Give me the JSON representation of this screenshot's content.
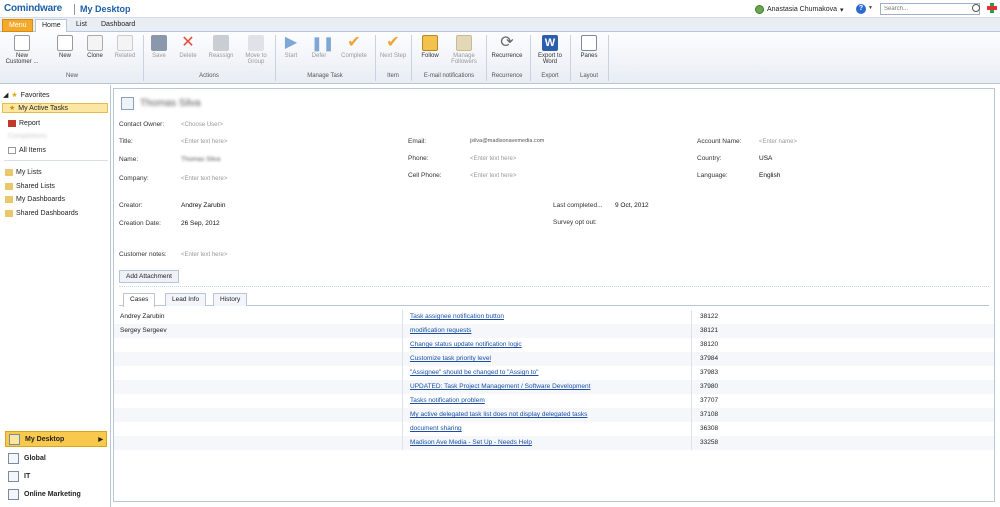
{
  "header": {
    "logo": "Comindware",
    "title": "My Desktop",
    "user": "Anastasia Chumakova",
    "search_placeholder": "Search..."
  },
  "tabs": [
    "Menu",
    "Home",
    "List",
    "Dashboard"
  ],
  "ribbon": {
    "groups": [
      "New",
      "Actions",
      "Manage Task",
      "Item",
      "E-mail notifications",
      "Recurrence",
      "Export",
      "Layout"
    ],
    "buttons": {
      "new_customer": "New Customer ...",
      "new": "New",
      "clone": "Clone",
      "related": "Related",
      "save": "Save",
      "delete": "Delete",
      "reassign": "Reassign",
      "move_to_group": "Move to Group",
      "start": "Start",
      "defer": "Defer",
      "complete": "Complete",
      "next_step": "Next Step",
      "follow": "Follow",
      "manage_followers": "Manage Followers",
      "recurrence": "Recurrence",
      "export_word": "Export to Word",
      "panes": "Panes"
    }
  },
  "sidebar": {
    "favorites": "Favorites",
    "my_active_tasks": "My Active Tasks",
    "report": "Report",
    "completions": "Completions",
    "all_items": "All Items",
    "my_lists": "My Lists",
    "shared_lists": "Shared Lists",
    "my_dashboards": "My Dashboards",
    "shared_dashboards": "Shared Dashboards",
    "workspaces": [
      "My Desktop",
      "Global",
      "IT",
      "Online Marketing"
    ]
  },
  "form": {
    "name_heading": "Thomas Silva",
    "contact_owner_label": "Contact Owner:",
    "contact_owner_placeholder": "<Choose User>",
    "title_label": "Title:",
    "title_placeholder": "<Enter text here>",
    "name_label": "Name:",
    "name_value": "Thomas Silva",
    "company_label": "Company:",
    "company_placeholder": "<Enter text here>",
    "email_label": "Email:",
    "email_value": "jsilva@madisonavemedia.com",
    "phone_label": "Phone:",
    "phone_placeholder": "<Enter text here>",
    "cell_label": "Cell Phone:",
    "cell_placeholder": "<Enter text here>",
    "account_label": "Account Name:",
    "account_placeholder": "<Enter name>",
    "country_label": "Country:",
    "country_value": "USA",
    "language_label": "Language:",
    "language_value": "English",
    "creator_label": "Creator:",
    "creator_value": "Andrey Zarubin",
    "created_label": "Creation Date:",
    "created_value": "26 Sep, 2012",
    "last_completed_label": "Last completed...",
    "last_completed_value": "9 Oct, 2012",
    "survey_label": "Survey opt out:",
    "notes_label": "Customer notes:",
    "notes_placeholder": "<Enter text here>",
    "attach_button": "Add Attachment"
  },
  "subtabs": [
    "Cases",
    "Lead Info",
    "History"
  ],
  "cases": [
    {
      "owner": "Andrey Zarubin",
      "title": "Task assignee notification button",
      "id": "38122"
    },
    {
      "owner": "Sergey Sergeev",
      "title": "modification requests",
      "id": "38121"
    },
    {
      "owner": "",
      "title": "Change status update notification logic",
      "id": "38120"
    },
    {
      "owner": "",
      "title": "Customize task priority level",
      "id": "37984"
    },
    {
      "owner": "",
      "title": "\"Assignee\" should be changed to \"Assign to\"",
      "id": "37983"
    },
    {
      "owner": "",
      "title": "UPDATED: Task Project Management / Software Development",
      "id": "37980"
    },
    {
      "owner": "",
      "title": "Tasks notification problem",
      "id": "37707"
    },
    {
      "owner": "",
      "title": "My active delegated task list does not display delegated tasks",
      "id": "37108"
    },
    {
      "owner": "",
      "title": "document sharing",
      "id": "36308"
    },
    {
      "owner": "",
      "title": "Madison Ave Media - Set Up - Needs Help",
      "id": "33258"
    }
  ]
}
